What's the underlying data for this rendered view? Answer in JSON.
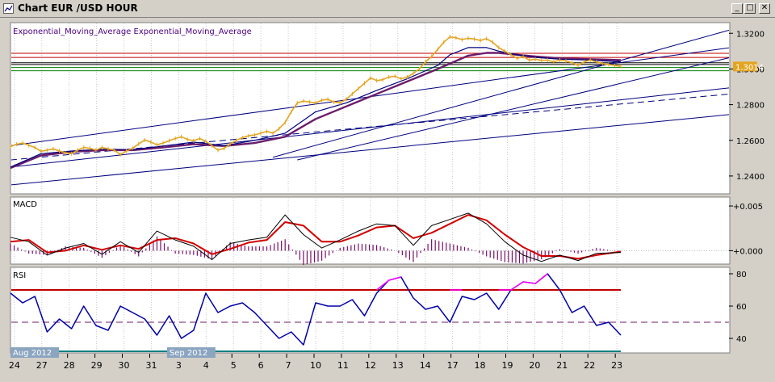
{
  "window": {
    "title": "Chart EUR /USD  HOUR",
    "buttons": {
      "minimize": "_",
      "maximize": "□",
      "close": "✕"
    }
  },
  "colors": {
    "background": "#d4d0c8",
    "chart_bg": "#ffffff",
    "price_line": "#e3a521",
    "ema_fast": "#000080",
    "ema_slow": "#6b1d6b",
    "trendline": "#000080",
    "macd_line": "#000000",
    "signal_line": "#d40000",
    "histogram": "#7a0f6a",
    "rsi_line": "#0000aa",
    "rsi_overbought_highlight": "#ff00ff",
    "level_red": "#c00000",
    "level_green": "#008000",
    "level_teal": "#008080",
    "current_price_label": "#e3a521"
  },
  "chart_data": [
    {
      "type": "line",
      "panel": "price",
      "legend_text": "Exponential_Moving_Average Exponential_Moving_Average",
      "ylim": [
        1.23,
        1.326
      ],
      "yticks": [
        "1.3200",
        "1.3000",
        "1.2800",
        "1.2600",
        "1.2400"
      ],
      "current_price_label": "1.3014",
      "horizontal_levels": [
        {
          "value": 1.3088,
          "color": "#c00000"
        },
        {
          "value": 1.3065,
          "color": "#c00000"
        },
        {
          "value": 1.3035,
          "color": "#000000"
        },
        {
          "value": 1.3025,
          "color": "#000000"
        },
        {
          "value": 1.3008,
          "color": "#008000"
        },
        {
          "value": 1.299,
          "color": "#008000"
        }
      ],
      "series": [
        {
          "name": "",
          "style": "price",
          "x": [
            0,
            1,
            2,
            3,
            4,
            5,
            6,
            7,
            8,
            9,
            10,
            11,
            12,
            13,
            14,
            15,
            16,
            17,
            18,
            19,
            20,
            21,
            22,
            23,
            24,
            25,
            26,
            27,
            28,
            29,
            30,
            31,
            32,
            33,
            34,
            35,
            36,
            37,
            38,
            39,
            40,
            41,
            42,
            43,
            44,
            45,
            46,
            47,
            48,
            49,
            50,
            51,
            52,
            53,
            54,
            55,
            56,
            57,
            58,
            59,
            60,
            61,
            62,
            63,
            64,
            65,
            66,
            67,
            68,
            69,
            70,
            71,
            72,
            73,
            74,
            75,
            76,
            77,
            78,
            79,
            80,
            81,
            82,
            83,
            84,
            85,
            86,
            87,
            88,
            89,
            90,
            91,
            92,
            93,
            94,
            95,
            96,
            97,
            98,
            99,
            100
          ],
          "values": [
            1.2565,
            1.2578,
            1.2585,
            1.2572,
            1.256,
            1.2538,
            1.2545,
            1.2552,
            1.254,
            1.253,
            1.2525,
            1.2545,
            1.256,
            1.2555,
            1.2545,
            1.256,
            1.2552,
            1.2545,
            1.252,
            1.254,
            1.2555,
            1.258,
            1.2602,
            1.259,
            1.2575,
            1.2585,
            1.2598,
            1.261,
            1.262,
            1.2605,
            1.2598,
            1.261,
            1.2595,
            1.257,
            1.2545,
            1.2555,
            1.258,
            1.26,
            1.2615,
            1.2625,
            1.263,
            1.264,
            1.265,
            1.264,
            1.2665,
            1.27,
            1.276,
            1.281,
            1.282,
            1.2815,
            1.281,
            1.2825,
            1.283,
            1.2815,
            1.281,
            1.283,
            1.286,
            1.289,
            1.292,
            1.295,
            1.2935,
            1.294,
            1.2955,
            1.296,
            1.2945,
            1.2955,
            1.2975,
            1.3,
            1.304,
            1.307,
            1.311,
            1.315,
            1.318,
            1.3175,
            1.3165,
            1.3172,
            1.3168,
            1.316,
            1.317,
            1.315,
            1.312,
            1.31,
            1.308,
            1.306,
            1.307,
            1.305,
            1.3055,
            1.3048,
            1.305,
            1.304,
            1.305,
            1.3045,
            1.3035,
            1.302,
            1.304,
            1.305,
            1.304,
            1.303,
            1.3025,
            1.302,
            1.3014
          ]
        },
        {
          "name": "",
          "style": "ema_fast",
          "x": [
            0,
            5,
            10,
            15,
            20,
            25,
            30,
            35,
            40,
            45,
            50,
            55,
            60,
            65,
            70,
            72,
            75,
            78,
            80,
            83,
            86,
            90,
            95,
            100
          ],
          "values": [
            1.245,
            1.2525,
            1.254,
            1.255,
            1.2548,
            1.2568,
            1.259,
            1.257,
            1.26,
            1.264,
            1.276,
            1.281,
            1.288,
            1.2945,
            1.302,
            1.308,
            1.312,
            1.312,
            1.31,
            1.308,
            1.3065,
            1.3055,
            1.305,
            1.304
          ]
        },
        {
          "name": "",
          "style": "ema_slow",
          "x": [
            0,
            5,
            10,
            15,
            20,
            25,
            30,
            35,
            40,
            45,
            50,
            55,
            60,
            65,
            70,
            75,
            78,
            80,
            83,
            86,
            90,
            95,
            100
          ],
          "values": [
            1.2445,
            1.2515,
            1.2535,
            1.2545,
            1.2545,
            1.256,
            1.2578,
            1.2568,
            1.2585,
            1.262,
            1.272,
            1.279,
            1.286,
            1.293,
            1.3,
            1.3075,
            1.309,
            1.309,
            1.308,
            1.307,
            1.306,
            1.3055,
            1.305
          ]
        }
      ],
      "trendlines": [
        {
          "from": [
            0,
            1.257
          ],
          "to": [
            118,
            1.312
          ],
          "dashed": false
        },
        {
          "from": [
            0,
            1.245
          ],
          "to": [
            118,
            1.2895
          ],
          "dashed": false
        },
        {
          "from": [
            0,
            1.235
          ],
          "to": [
            118,
            1.2745
          ],
          "dashed": false
        },
        {
          "from": [
            0,
            1.249
          ],
          "to": [
            118,
            1.286
          ],
          "dashed": true
        },
        {
          "from": [
            43,
            1.2505
          ],
          "to": [
            118,
            1.322
          ],
          "dashed": false
        },
        {
          "from": [
            47,
            1.249
          ],
          "to": [
            118,
            1.3065
          ],
          "dashed": false
        }
      ]
    },
    {
      "type": "line",
      "panel": "macd",
      "title": "MACD",
      "ylim": [
        -0.0015,
        0.006
      ],
      "yticks": [
        "+0.005",
        "+0.000"
      ],
      "series": [
        {
          "name": "",
          "style": "macd",
          "x": [
            0,
            3,
            6,
            9,
            12,
            15,
            18,
            21,
            24,
            27,
            30,
            33,
            36,
            39,
            42,
            45,
            48,
            51,
            54,
            57,
            60,
            63,
            66,
            69,
            72,
            75,
            78,
            81,
            84,
            87,
            90,
            93,
            96,
            100
          ],
          "values": [
            0.0015,
            0.001,
            -0.0005,
            0.0003,
            0.0008,
            -0.0004,
            0.001,
            -0.0002,
            0.0022,
            0.0012,
            0.0005,
            -0.001,
            0.0008,
            0.0012,
            0.0015,
            0.004,
            0.0018,
            0.0003,
            0.0012,
            0.0022,
            0.003,
            0.0028,
            0.0006,
            0.0028,
            0.0035,
            0.0042,
            0.003,
            0.001,
            -0.0005,
            -0.0012,
            -0.0005,
            -0.0011,
            -0.0003,
            -0.0002
          ]
        },
        {
          "name": "",
          "style": "signal",
          "x": [
            0,
            3,
            6,
            9,
            12,
            15,
            18,
            21,
            24,
            27,
            30,
            33,
            36,
            39,
            42,
            45,
            48,
            51,
            54,
            57,
            60,
            63,
            66,
            69,
            72,
            75,
            78,
            81,
            84,
            87,
            90,
            93,
            96,
            100
          ],
          "values": [
            0.001,
            0.0012,
            -0.0002,
            0.0,
            0.0006,
            0.0001,
            0.0006,
            0.0002,
            0.0012,
            0.0014,
            0.0008,
            -0.0004,
            0.0002,
            0.0009,
            0.0012,
            0.0032,
            0.0028,
            0.001,
            0.001,
            0.0017,
            0.0026,
            0.0028,
            0.0014,
            0.002,
            0.003,
            0.004,
            0.0034,
            0.0018,
            0.0004,
            -0.0006,
            -0.0006,
            -0.0009,
            -0.0005,
            -0.0001
          ]
        }
      ]
    },
    {
      "type": "line",
      "panel": "rsi",
      "title": "RSI",
      "ylim": [
        31,
        84
      ],
      "yticks": [
        "80",
        "60",
        "40"
      ],
      "levels": {
        "overbought": 70,
        "mid": 50,
        "oversold": 30
      },
      "series": [
        {
          "name": "",
          "style": "rsi",
          "x": [
            0,
            2,
            4,
            6,
            8,
            10,
            12,
            14,
            16,
            18,
            20,
            22,
            24,
            26,
            28,
            30,
            32,
            34,
            36,
            38,
            40,
            42,
            44,
            46,
            48,
            50,
            52,
            54,
            56,
            58,
            60,
            62,
            64,
            66,
            68,
            70,
            72,
            74,
            76,
            78,
            80,
            82,
            84,
            86,
            88,
            90,
            92,
            94,
            96,
            98,
            100
          ],
          "values": [
            68,
            62,
            66,
            44,
            52,
            46,
            60,
            48,
            45,
            60,
            56,
            52,
            42,
            54,
            40,
            45,
            68,
            56,
            60,
            62,
            56,
            48,
            40,
            44,
            36,
            62,
            60,
            60,
            64,
            54,
            68,
            76,
            78,
            65,
            58,
            60,
            50,
            66,
            64,
            68,
            58,
            70,
            75,
            74,
            80,
            70,
            56,
            60,
            48,
            50,
            42
          ]
        }
      ],
      "overbought_segments": [
        [
          59,
          62
        ],
        [
          72,
          73
        ],
        [
          79,
          86
        ]
      ]
    }
  ],
  "x_axis": {
    "ticks": [
      {
        "pos": 0.5,
        "label": "24"
      },
      {
        "pos": 4,
        "label": "27"
      },
      {
        "pos": 7.5,
        "label": "28"
      },
      {
        "pos": 11,
        "label": "29"
      },
      {
        "pos": 14.5,
        "label": "30"
      },
      {
        "pos": 18,
        "label": "31"
      },
      {
        "pos": 21.5,
        "label": "3"
      },
      {
        "pos": 25,
        "label": "4"
      },
      {
        "pos": 28.5,
        "label": "5"
      },
      {
        "pos": 32,
        "label": "6"
      },
      {
        "pos": 35.5,
        "label": "7"
      },
      {
        "pos": 39,
        "label": "10"
      },
      {
        "pos": 42.5,
        "label": "11"
      },
      {
        "pos": 46,
        "label": "12"
      },
      {
        "pos": 49.5,
        "label": "13"
      },
      {
        "pos": 53,
        "label": "14"
      },
      {
        "pos": 56.5,
        "label": "17"
      },
      {
        "pos": 60,
        "label": "18"
      },
      {
        "pos": 63.5,
        "label": "19"
      },
      {
        "pos": 67,
        "label": "20"
      },
      {
        "pos": 70.5,
        "label": "21"
      },
      {
        "pos": 74,
        "label": "22"
      },
      {
        "pos": 77.5,
        "label": "23"
      }
    ],
    "month_labels": [
      {
        "pos": 0,
        "label": "Aug 2012"
      },
      {
        "pos": 20,
        "label": "Sep 2012"
      }
    ]
  }
}
